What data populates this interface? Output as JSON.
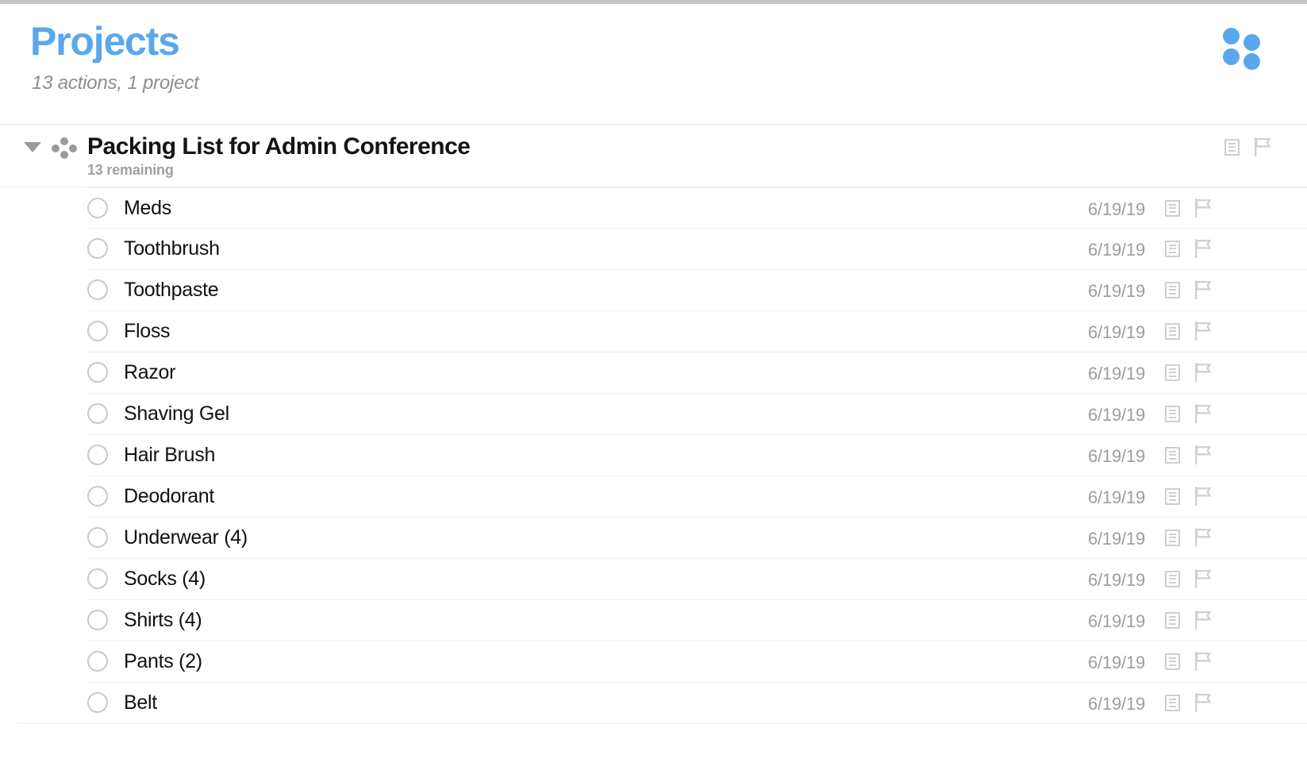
{
  "window": {
    "title": "Projects"
  },
  "header": {
    "title": "Projects",
    "subtitle": "13 actions, 1 project",
    "perspective_icon": "four-dots-icon",
    "accent_color": "#5aa7ee",
    "muted_color": "#8e8e93"
  },
  "project": {
    "disclosure_state": "expanded",
    "disclosure_icon": "triangle-down-icon",
    "status_icon": "project-dots-icon",
    "title": "Packing List for Admin Conference",
    "remaining": "13 remaining",
    "note_icon": "note-icon",
    "flag_icon": "flag-icon"
  },
  "columns": {
    "checkbox": "status",
    "title": "name",
    "date": "due date",
    "note": "note",
    "flag": "flag"
  },
  "tasks": [
    {
      "title": "Meds",
      "date": "6/19/19",
      "checked": false,
      "note_icon": "note-icon",
      "flag_icon": "flag-icon"
    },
    {
      "title": "Toothbrush",
      "date": "6/19/19",
      "checked": false,
      "note_icon": "note-icon",
      "flag_icon": "flag-icon"
    },
    {
      "title": "Toothpaste",
      "date": "6/19/19",
      "checked": false,
      "note_icon": "note-icon",
      "flag_icon": "flag-icon"
    },
    {
      "title": "Floss",
      "date": "6/19/19",
      "checked": false,
      "note_icon": "note-icon",
      "flag_icon": "flag-icon"
    },
    {
      "title": "Razor",
      "date": "6/19/19",
      "checked": false,
      "note_icon": "note-icon",
      "flag_icon": "flag-icon"
    },
    {
      "title": "Shaving Gel",
      "date": "6/19/19",
      "checked": false,
      "note_icon": "note-icon",
      "flag_icon": "flag-icon"
    },
    {
      "title": "Hair Brush",
      "date": "6/19/19",
      "checked": false,
      "note_icon": "note-icon",
      "flag_icon": "flag-icon"
    },
    {
      "title": "Deodorant",
      "date": "6/19/19",
      "checked": false,
      "note_icon": "note-icon",
      "flag_icon": "flag-icon"
    },
    {
      "title": "Underwear (4)",
      "date": "6/19/19",
      "checked": false,
      "note_icon": "note-icon",
      "flag_icon": "flag-icon"
    },
    {
      "title": "Socks (4)",
      "date": "6/19/19",
      "checked": false,
      "note_icon": "note-icon",
      "flag_icon": "flag-icon"
    },
    {
      "title": "Shirts (4)",
      "date": "6/19/19",
      "checked": false,
      "note_icon": "note-icon",
      "flag_icon": "flag-icon"
    },
    {
      "title": "Pants (2)",
      "date": "6/19/19",
      "checked": false,
      "note_icon": "note-icon",
      "flag_icon": "flag-icon"
    },
    {
      "title": "Belt",
      "date": "6/19/19",
      "checked": false,
      "note_icon": "note-icon",
      "flag_icon": "flag-icon"
    }
  ]
}
